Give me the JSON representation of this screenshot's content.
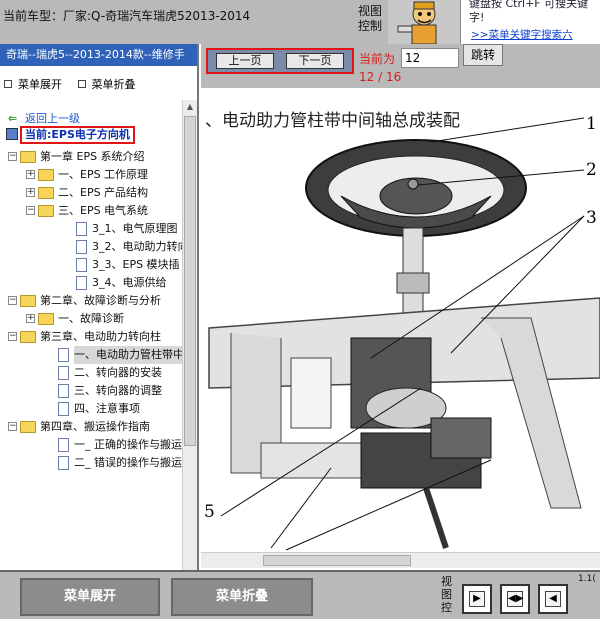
{
  "topbar": {
    "car_model": "当前车型：厂家:Q-奇瑞汽车瑞虎52013-2014",
    "view_control": "视图控制",
    "hint_text": "键盘按 Ctrl+F 可搜关键字!",
    "hint_link": ">>菜单关键字搜索六"
  },
  "sidebar": {
    "title": "奇瑞--瑞虎5--2013-2014款--维修手",
    "expand_label": "菜单展开",
    "collapse_label": "菜单折叠",
    "back_label": "返回上一级",
    "current_label": "当前:EPS电子方向机"
  },
  "tree": [
    {
      "label": "第一章 EPS 系统介绍",
      "box": "−",
      "type": "folder"
    },
    {
      "label": "一、EPS 工作原理",
      "box": "+",
      "type": "folder"
    },
    {
      "label": "二、EPS 产品结构",
      "box": "+",
      "type": "folder"
    },
    {
      "label": "三、EPS 电气系统",
      "box": "−",
      "type": "folder"
    },
    {
      "label": "3_1、电气原理图",
      "box": "",
      "type": "page"
    },
    {
      "label": "3_2、电动助力转向",
      "box": "",
      "type": "page"
    },
    {
      "label": "3_3、EPS 模块插",
      "box": "",
      "type": "page"
    },
    {
      "label": "3_4、电源供给",
      "box": "",
      "type": "page"
    },
    {
      "label": "第二章、故障诊断与分析",
      "box": "−",
      "type": "folder"
    },
    {
      "label": "一、故障诊断",
      "box": "+",
      "type": "folder"
    },
    {
      "label": "第三章、电动助力转向柱",
      "box": "−",
      "type": "folder"
    },
    {
      "label": "一、电动助力管柱带中",
      "box": "",
      "type": "page"
    },
    {
      "label": "二、转向器的安装",
      "box": "",
      "type": "page"
    },
    {
      "label": "三、转向器的调整",
      "box": "",
      "type": "page"
    },
    {
      "label": "四、注意事项",
      "box": "",
      "type": "page"
    },
    {
      "label": "第四章、搬运操作指南",
      "box": "−",
      "type": "folder"
    },
    {
      "label": "一_ 正确的操作与搬运",
      "box": "",
      "type": "page"
    },
    {
      "label": "二_ 错误的操作与搬运",
      "box": "",
      "type": "page"
    }
  ],
  "nav": {
    "prev_label": "上一页",
    "next_label": "下一页",
    "current_prefix": "当前为",
    "page_count": "12 / 16",
    "page_input_value": "12",
    "jump_label": "跳转"
  },
  "doc": {
    "title": "、电动助力管柱带中间轴总成装配",
    "callouts": [
      "1",
      "2",
      "3",
      "5"
    ]
  },
  "bottom": {
    "expand_label": "菜单展开",
    "collapse_label": "菜单折叠",
    "view_label": "视图控",
    "tiny_label": "1.1("
  }
}
